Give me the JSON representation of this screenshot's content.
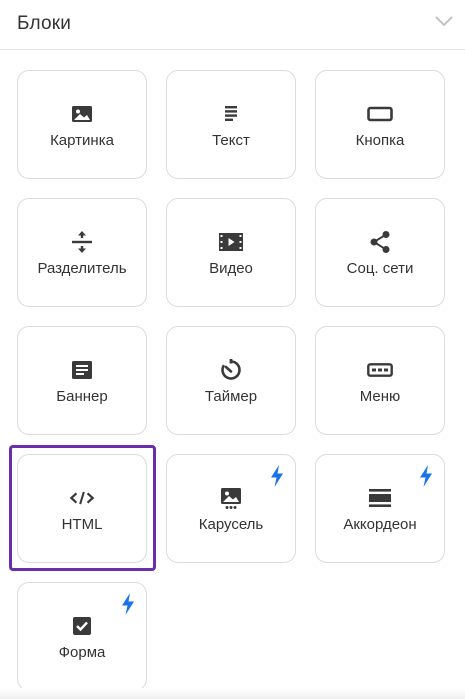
{
  "header": {
    "title": "Блоки",
    "chevron_icon": "chevron-down-icon"
  },
  "tiles": [
    {
      "id": "image",
      "label": "Картинка",
      "icon": "image-icon",
      "premium": false
    },
    {
      "id": "text",
      "label": "Текст",
      "icon": "text-icon",
      "premium": false
    },
    {
      "id": "button",
      "label": "Кнопка",
      "icon": "button-icon",
      "premium": false
    },
    {
      "id": "divider",
      "label": "Разделитель",
      "icon": "divider-icon",
      "premium": false
    },
    {
      "id": "video",
      "label": "Видео",
      "icon": "video-icon",
      "premium": false
    },
    {
      "id": "social",
      "label": "Соц. сети",
      "icon": "share-icon",
      "premium": false
    },
    {
      "id": "banner",
      "label": "Баннер",
      "icon": "banner-icon",
      "premium": false
    },
    {
      "id": "timer",
      "label": "Таймер",
      "icon": "timer-icon",
      "premium": false
    },
    {
      "id": "menu",
      "label": "Меню",
      "icon": "menu-icon",
      "premium": false
    },
    {
      "id": "html",
      "label": "HTML",
      "icon": "code-icon",
      "premium": false,
      "selected": true
    },
    {
      "id": "carousel",
      "label": "Карусель",
      "icon": "carousel-icon",
      "premium": true
    },
    {
      "id": "accordion",
      "label": "Аккордеон",
      "icon": "accordion-icon",
      "premium": true
    },
    {
      "id": "form",
      "label": "Форма",
      "icon": "checkbox-icon",
      "premium": true
    }
  ],
  "colors": {
    "icon": "#3a3a3a",
    "bolt": "#1a73e8",
    "selection": "#6a2fa6",
    "border": "#dcdcdc"
  }
}
